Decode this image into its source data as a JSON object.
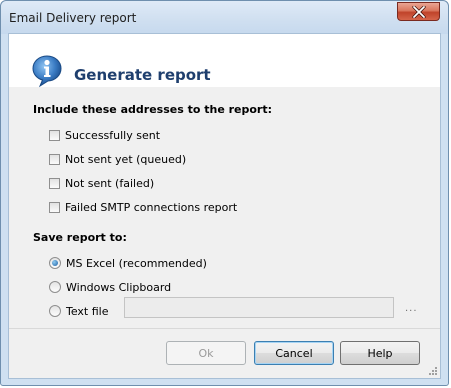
{
  "window": {
    "title": "Email Delivery report"
  },
  "header": {
    "heading": "Generate report",
    "icon": "info-icon"
  },
  "include_section": {
    "label": "Include these addresses to the report:",
    "options": [
      {
        "label": "Successfully sent",
        "checked": false
      },
      {
        "label": "Not sent yet (queued)",
        "checked": false
      },
      {
        "label": "Not sent (failed)",
        "checked": false
      },
      {
        "label": "Failed SMTP connections report",
        "checked": false
      }
    ]
  },
  "save_section": {
    "label": "Save report to:",
    "options": [
      {
        "label": "MS Excel (recommended)",
        "selected": true
      },
      {
        "label": "Windows Clipboard",
        "selected": false
      },
      {
        "label": "Text file",
        "selected": false
      }
    ],
    "text_file_path": "",
    "browse_label": "..."
  },
  "buttons": {
    "ok": "Ok",
    "cancel": "Cancel",
    "help": "Help"
  }
}
